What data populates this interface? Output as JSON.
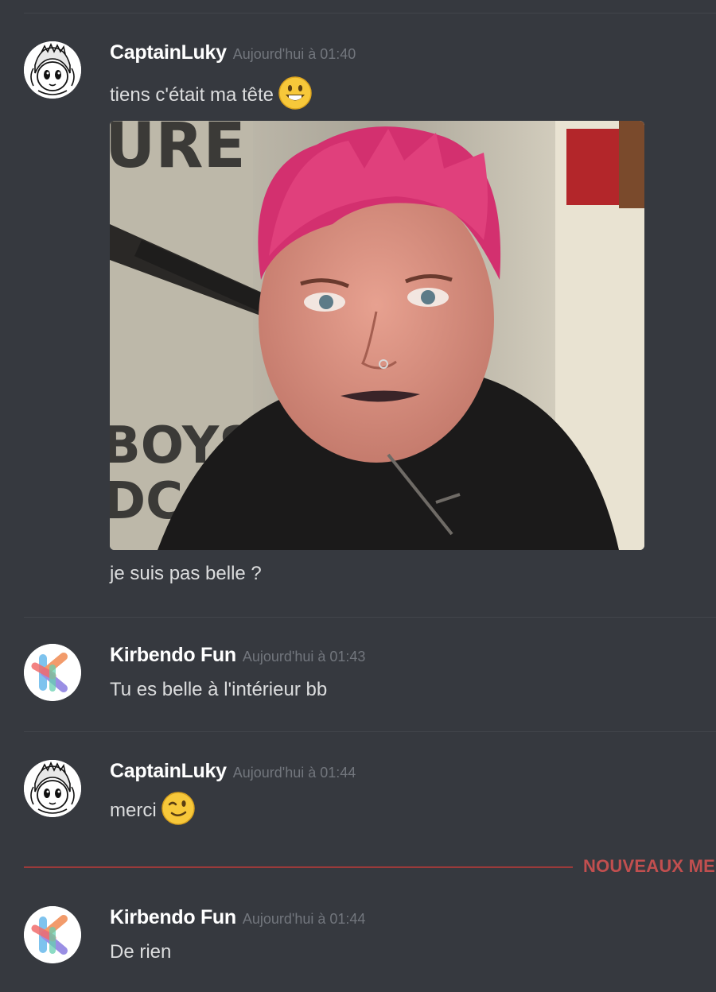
{
  "messages": [
    {
      "author": "CaptainLuky",
      "timestamp": "Aujourd'hui à 01:40",
      "avatar_icon": "manga-character-avatar-icon",
      "lines": [
        "tiens c'était ma tête",
        "je suis pas belle ?"
      ],
      "emoji": "smiley-emoji",
      "attachment": "photo of a person with bright pink spiky hair"
    },
    {
      "author": "Kirbendo Fun",
      "timestamp": "Aujourd'hui à 01:43",
      "avatar_icon": "kirbendo-logo-icon",
      "lines": [
        "Tu es belle à l'intérieur bb"
      ]
    },
    {
      "author": "CaptainLuky",
      "timestamp": "Aujourd'hui à 01:44",
      "avatar_icon": "manga-character-avatar-icon",
      "lines": [
        "merci"
      ],
      "emoji": "wink-emoji"
    },
    {
      "author": "Kirbendo Fun",
      "timestamp": "Aujourd'hui à 01:44",
      "avatar_icon": "kirbendo-logo-icon",
      "lines": [
        "De rien"
      ]
    }
  ],
  "new_messages_label": "NOUVEAUX ME",
  "colors": {
    "background": "#36393f",
    "username": "#ffffff",
    "timestamp": "#72767d",
    "text": "#dcddde",
    "new_messages": "#c14f4f"
  }
}
